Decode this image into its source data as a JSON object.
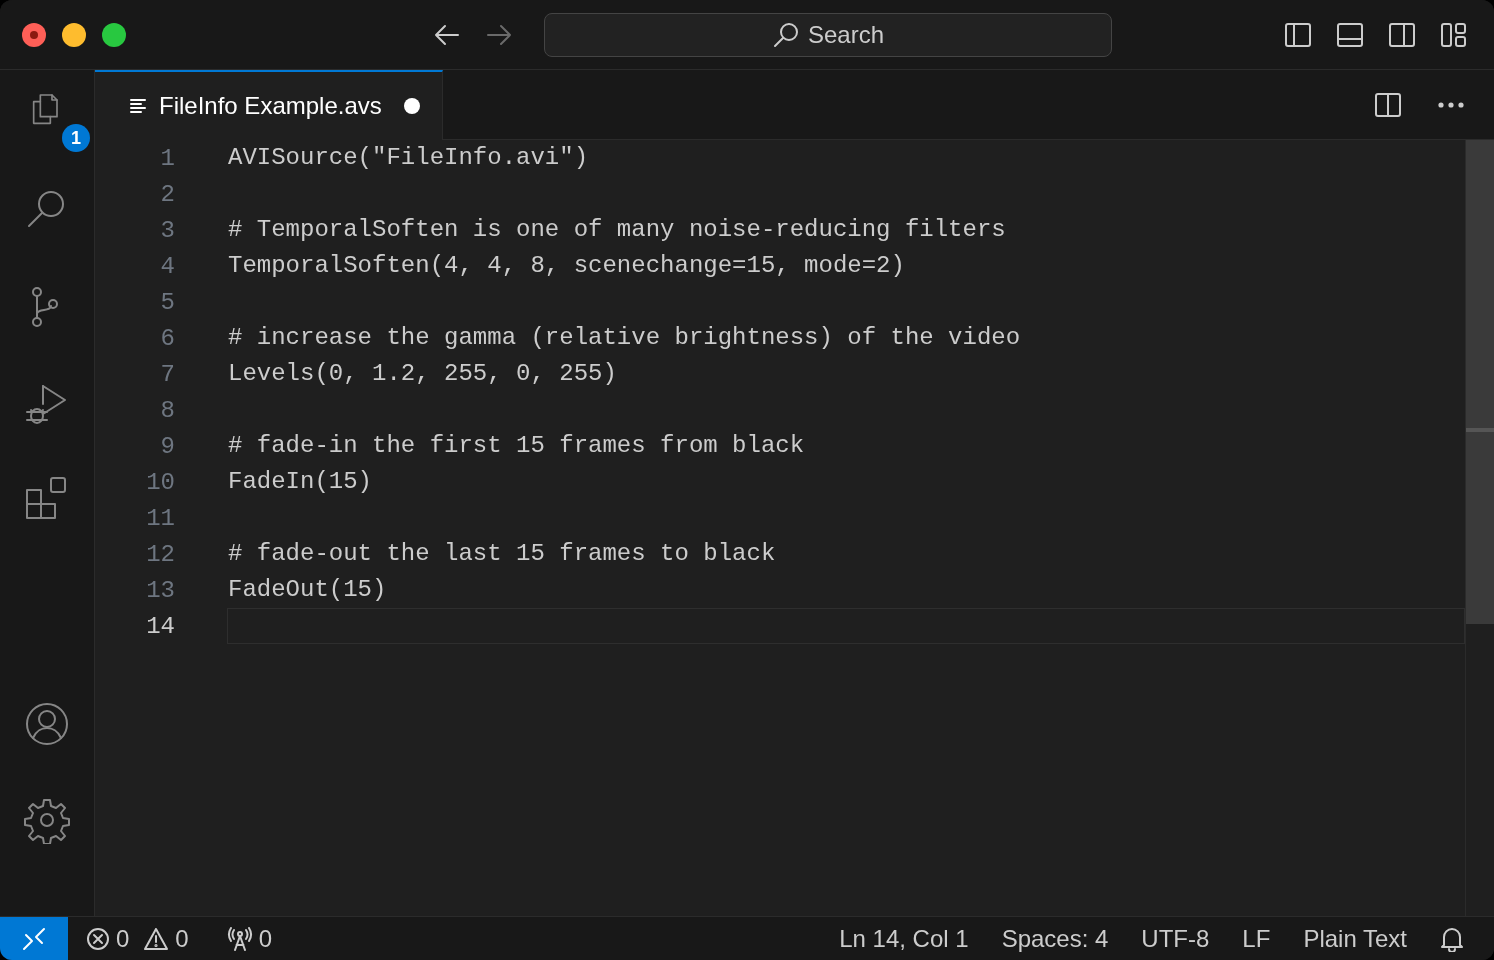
{
  "title_bar": {
    "traffic_lights": [
      {
        "kind": "close",
        "color": "#fe5f57"
      },
      {
        "kind": "minimize",
        "color": "#febc2e"
      },
      {
        "kind": "zoom",
        "color": "#28c840"
      }
    ],
    "nav": [
      {
        "kind": "back",
        "disabled": false
      },
      {
        "kind": "forward",
        "disabled": true
      }
    ],
    "search": {
      "label": "Search"
    },
    "layout_buttons": [
      {
        "kind": "primary-sidebar"
      },
      {
        "kind": "panel"
      },
      {
        "kind": "secondary-sidebar"
      },
      {
        "kind": "customize-layout"
      }
    ]
  },
  "activity_bar": {
    "items": [
      {
        "kind": "explorer",
        "badge": "1"
      },
      {
        "kind": "search"
      },
      {
        "kind": "source-control"
      },
      {
        "kind": "run-debug"
      },
      {
        "kind": "extensions"
      }
    ],
    "bottom_items": [
      {
        "kind": "accounts"
      },
      {
        "kind": "settings"
      }
    ]
  },
  "tabs": [
    {
      "label": "FileInfo Example.avs",
      "selected": true,
      "modified": true
    }
  ],
  "editor": {
    "lines": [
      {
        "number": "1",
        "text": "AVISource(\"FileInfo.avi\")",
        "current": false
      },
      {
        "number": "2",
        "current": false
      },
      {
        "number": "3",
        "text": "# TemporalSoften is one of many noise-reducing filters",
        "current": false
      },
      {
        "number": "4",
        "text": "TemporalSoften(4, 4, 8, scenechange=15, mode=2)",
        "current": false
      },
      {
        "number": "5",
        "current": false
      },
      {
        "number": "6",
        "text": "# increase the gamma (relative brightness) of the video",
        "current": false
      },
      {
        "number": "7",
        "text": "Levels(0, 1.2, 255, 0, 255)",
        "current": false
      },
      {
        "number": "8",
        "current": false
      },
      {
        "number": "9",
        "text": "# fade-in the first 15 frames from black",
        "current": false
      },
      {
        "number": "10",
        "text": "FadeIn(15)",
        "current": false
      },
      {
        "number": "11",
        "current": false
      },
      {
        "number": "12",
        "text": "# fade-out the last 15 frames to black",
        "current": false
      },
      {
        "number": "13",
        "text": "FadeOut(15)",
        "current": false
      },
      {
        "number": "14",
        "current": true
      }
    ]
  },
  "status_bar": {
    "errors": "0",
    "warnings": "0",
    "ports": "0",
    "items": [
      "Ln 14, Col 1",
      "Spaces: 4",
      "UTF-8",
      "LF",
      "Plain Text"
    ]
  }
}
